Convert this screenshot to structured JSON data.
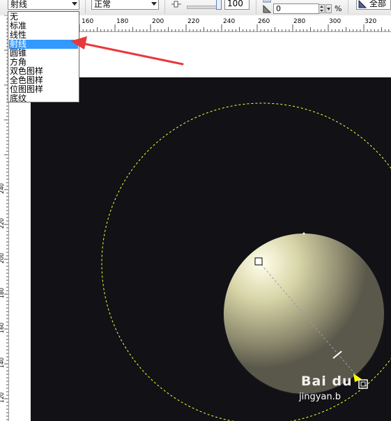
{
  "toolbar": {
    "fill_type": "射线",
    "blend_mode": "正常",
    "transparency_value": "100",
    "angle_value": "0",
    "percent_label": "%",
    "target_label": "全部"
  },
  "fill_type_options": [
    "无",
    "标准",
    "线性",
    "射线",
    "圆锥",
    "方角",
    "双色图样",
    "全色图样",
    "位图图样",
    "底纹"
  ],
  "selected_index": 3,
  "ruler_h": [
    "160",
    "180",
    "200",
    "220",
    "240",
    "260",
    "280",
    "300",
    "320"
  ],
  "ruler_v": [
    "240",
    "220",
    "200",
    "180",
    "160",
    "140",
    "120"
  ],
  "watermark": {
    "brand": "Bai du",
    "sub": "jingyan.b"
  },
  "colors": {
    "canvas": "#111116",
    "highlight": "#3399ff",
    "arrow": "#e8383c",
    "guide": "#ffff33"
  }
}
